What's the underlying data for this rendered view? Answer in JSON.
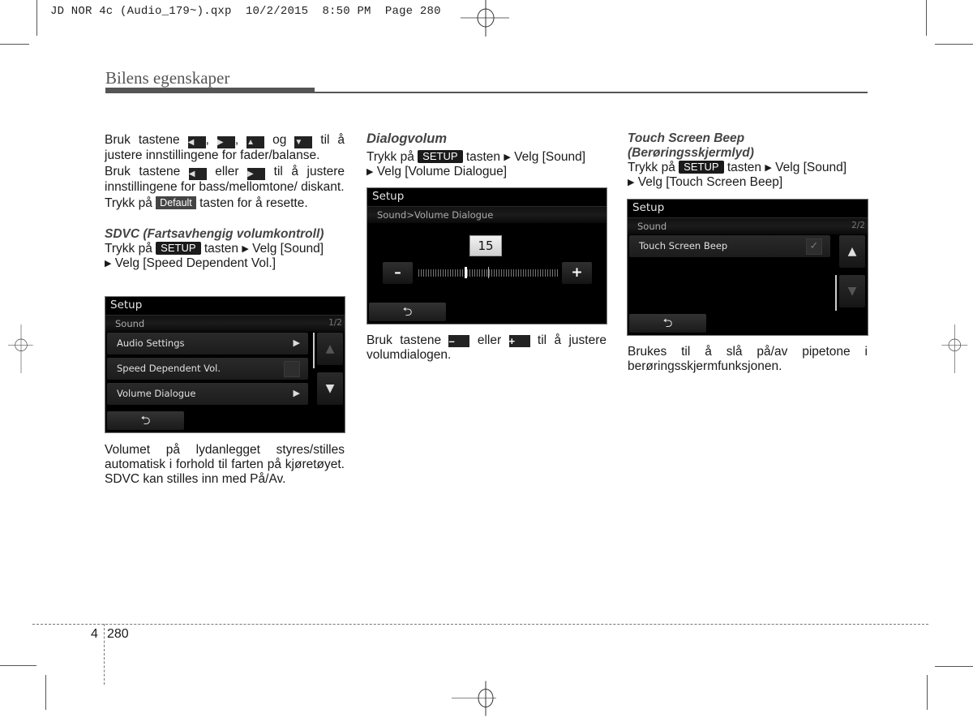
{
  "slug": "JD NOR 4c (Audio_179~).qxp  10/2/2015  8:50 PM  Page 280",
  "section_title": "Bilens egenskaper",
  "keys": {
    "left": "◀",
    "right": "▶",
    "up": "▲",
    "down": "▼",
    "default": "Default",
    "setup": "SETUP",
    "minus": "–",
    "plus": "+"
  },
  "col1": {
    "p1_a": "Bruk tastene",
    "p1_sep1": ",",
    "p1_sep2": ",",
    "p1_og": "og",
    "p1_b": "til å justere innstillingene for fader/balanse.",
    "p2_a": "Bruk tastene",
    "p2_eller": "eller",
    "p2_b": "til å justere innstillingene for bass/mellomtone/ diskant.",
    "p3_a": "Trykk på",
    "p3_b": "tasten for å resette.",
    "sdvc_heading": "SDVC (Fartsavhengig volumkontroll)",
    "sdvc_p_a": "Trykk på",
    "sdvc_p_b": "tasten",
    "sdvc_p_c": "Velg [Sound]",
    "sdvc_p_d": "Velg [Speed Dependent Vol.]",
    "sdvc_desc": "Volumet på lydanlegget styres/stilles automatisk i forhold til farten på kjøretøyet. SDVC kan stilles inn med På/Av."
  },
  "screen1": {
    "title": "Setup",
    "subtitle": "Sound",
    "page": "1/2",
    "rows": [
      {
        "label": "Audio Settings",
        "type": "arrow",
        "icon": "▶"
      },
      {
        "label": "Speed Dependent Vol.",
        "type": "checkbox",
        "checked": false
      },
      {
        "label": "Volume Dialogue",
        "type": "arrow",
        "icon": "▶"
      }
    ],
    "up_icon": "▲",
    "down_icon": "▼",
    "back_icon": "⮌"
  },
  "col2": {
    "heading": "Dialogvolum",
    "p_a": "Trykk på",
    "p_b": "tasten",
    "p_c": "Velg [Sound]",
    "p_d": "Velg [Volume Dialogue]",
    "desc_a": "Bruk tastene",
    "desc_eller": "eller",
    "desc_b": "til å justere volumdialogen."
  },
  "screen2": {
    "title": "Setup",
    "subtitle": "Sound>Volume Dialogue",
    "value": "15",
    "slider_fraction": 0.33,
    "minus": "–",
    "plus": "+",
    "back_icon": "⮌"
  },
  "col3": {
    "heading1": "Touch Screen Beep",
    "heading2": "(Berøringsskjermlyd)",
    "p_a": "Trykk på",
    "p_b": "tasten",
    "p_c": "Velg [Sound]",
    "p_d": "Velg [Touch Screen Beep]",
    "desc": "Brukes til å slå på/av pipetone i berøringsskjermfunksjonen."
  },
  "screen3": {
    "title": "Setup",
    "subtitle": "Sound",
    "page": "2/2",
    "rows": [
      {
        "label": "Touch Screen Beep",
        "type": "checkbox",
        "checked": true,
        "icon": "✓"
      }
    ],
    "up_icon": "▲",
    "down_icon": "▼",
    "back_icon": "⮌"
  },
  "footer": {
    "chapter": "4",
    "page": "280"
  },
  "arrow_glyph": "▶"
}
